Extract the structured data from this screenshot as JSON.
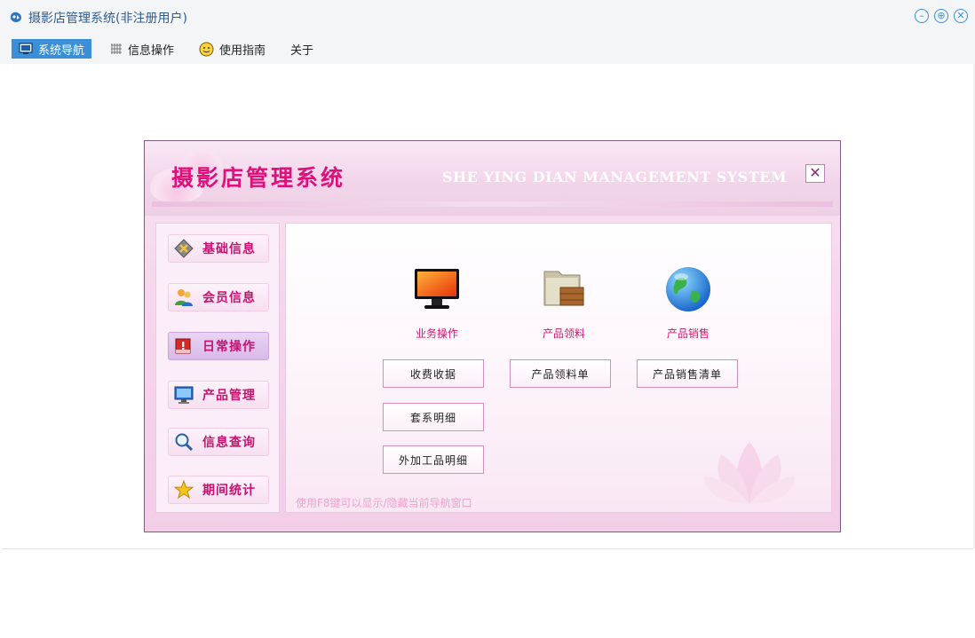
{
  "window": {
    "title": "摄影店管理系统(非注册用户)",
    "controls": [
      "minimize-icon",
      "restore-icon",
      "close-icon"
    ]
  },
  "menubar": {
    "items": [
      {
        "label": "系统导航",
        "icon": "monitor-icon",
        "active": true
      },
      {
        "label": "信息操作",
        "icon": "grid-icon",
        "active": false
      },
      {
        "label": "使用指南",
        "icon": "smiley-icon",
        "active": false
      },
      {
        "label": "关于",
        "icon": "",
        "active": false
      }
    ]
  },
  "dialog": {
    "title": "摄影店管理系统",
    "subtitle": "SHE YING DIAN MANAGEMENT SYSTEM",
    "close_label": "✕",
    "sidebar": [
      {
        "label": "基础信息",
        "icon": "tools-diamond-icon",
        "active": false
      },
      {
        "label": "会员信息",
        "icon": "users-icon",
        "active": false
      },
      {
        "label": "日常操作",
        "icon": "alert-calendar-icon",
        "active": true
      },
      {
        "label": "产品管理",
        "icon": "monitor-icon",
        "active": false
      },
      {
        "label": "信息查询",
        "icon": "magnifier-icon",
        "active": false
      },
      {
        "label": "期间统计",
        "icon": "star-icon",
        "active": false
      }
    ],
    "features": [
      {
        "label": "业务操作",
        "icon": "monitor-icon"
      },
      {
        "label": "产品领料",
        "icon": "folder-box-icon"
      },
      {
        "label": "产品销售",
        "icon": "globe-icon"
      }
    ],
    "actions": {
      "col1": [
        "收费收据",
        "套系明细",
        "外加工品明细"
      ],
      "col2": [
        "产品领料单"
      ],
      "col3": [
        "产品销售清单"
      ]
    },
    "hint": "使用F8键可以显示/隐藏当前导航窗口"
  },
  "colors": {
    "accent": "#3a8fd8",
    "brand_pink": "#e0107a",
    "label_pink": "#d4176f"
  }
}
